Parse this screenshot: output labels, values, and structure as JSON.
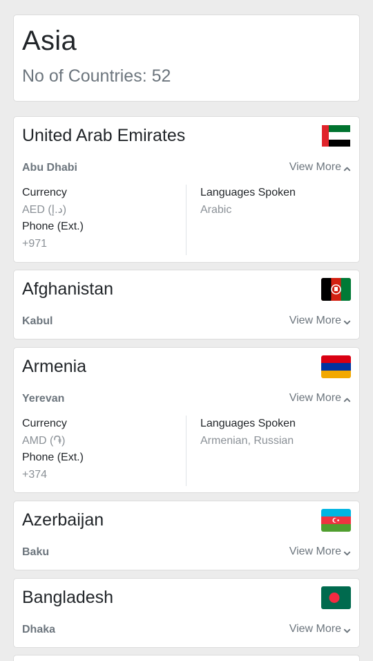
{
  "header": {
    "title": "Asia",
    "count_text": "No of Countries: 52"
  },
  "labels": {
    "currency": "Currency",
    "phone": "Phone (Ext.)",
    "languages": "Languages Spoken"
  },
  "countries": [
    {
      "name": "United Arab Emirates",
      "capital": "Abu Dhabi",
      "view_more": "View More",
      "expanded": true,
      "currency": "AED (د.إ)",
      "phone": "+971",
      "languages": "Arabic",
      "flag_icon": "flag-uae-icon"
    },
    {
      "name": "Afghanistan",
      "capital": "Kabul",
      "view_more": "View More",
      "expanded": false,
      "flag_icon": "flag-afghanistan-icon"
    },
    {
      "name": "Armenia",
      "capital": "Yerevan",
      "view_more": "View More",
      "expanded": true,
      "currency": "AMD (֏)",
      "phone": "+374",
      "languages": "Armenian, Russian",
      "flag_icon": "flag-armenia-icon"
    },
    {
      "name": "Azerbaijan",
      "capital": "Baku",
      "view_more": "View More",
      "expanded": false,
      "flag_icon": "flag-azerbaijan-icon"
    },
    {
      "name": "Bangladesh",
      "capital": "Dhaka",
      "view_more": "View More",
      "expanded": false,
      "flag_icon": "flag-bangladesh-icon"
    }
  ],
  "colors": {
    "page_bg": "#ececec",
    "card_bg": "#ffffff",
    "muted_text": "#6c757d",
    "value_text": "#8a9096"
  }
}
